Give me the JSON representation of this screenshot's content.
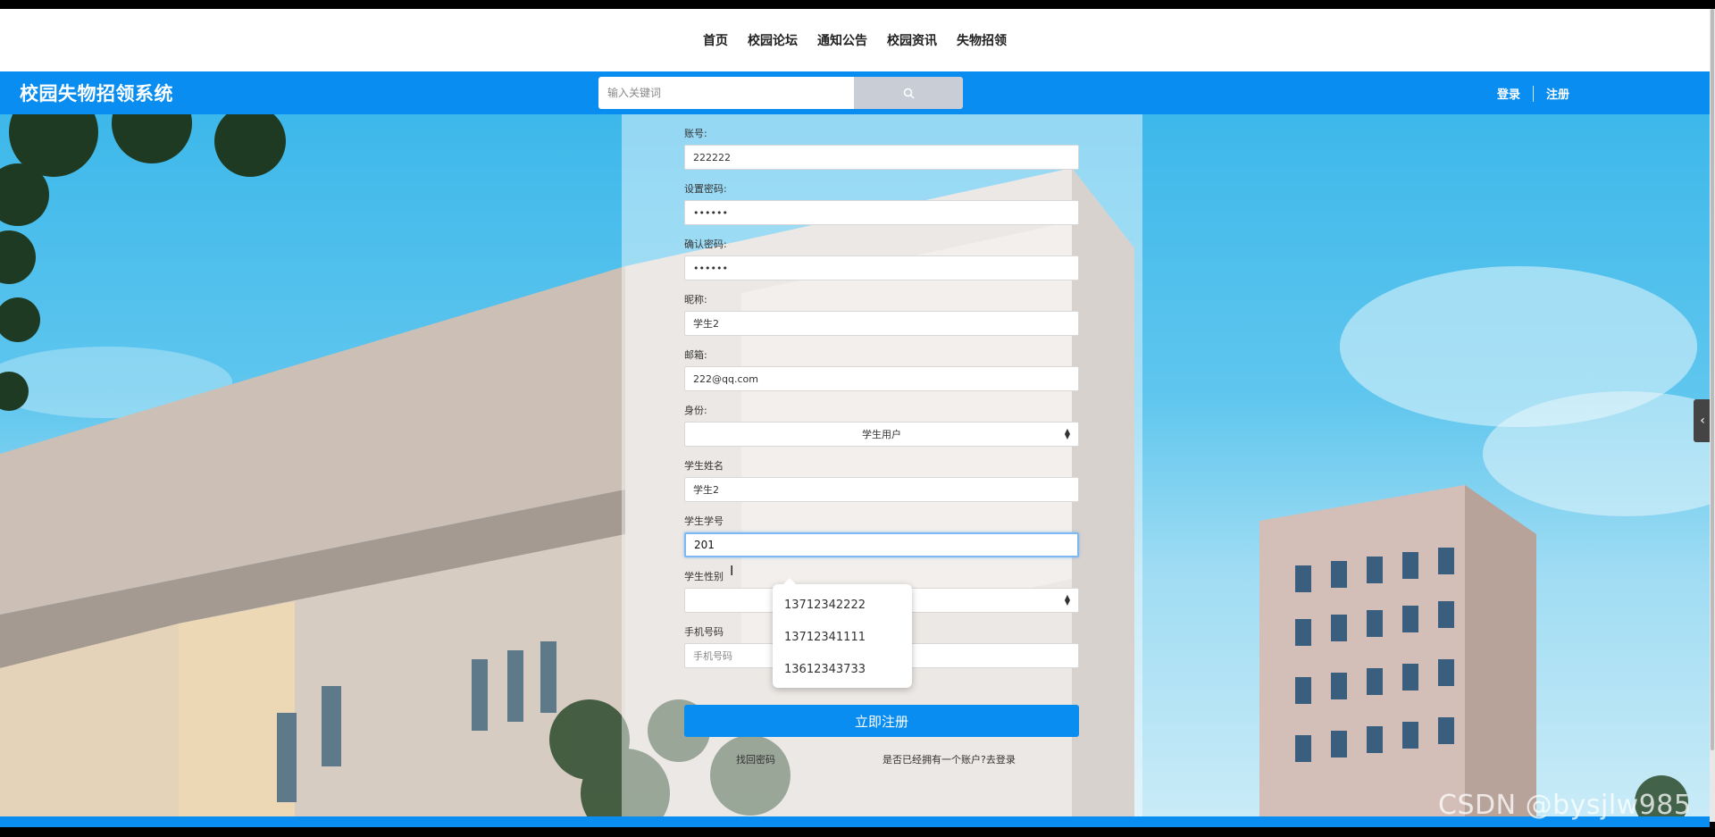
{
  "nav": {
    "items": [
      "首页",
      "校园论坛",
      "通知公告",
      "校园资讯",
      "失物招领"
    ]
  },
  "header": {
    "brand": "校园失物招领系统",
    "search_placeholder": "输入关键词",
    "login": "登录",
    "register": "注册"
  },
  "form": {
    "account_label": "账号:",
    "account_value": "222222",
    "password_label": "设置密码:",
    "password_value": "••••••",
    "confirm_label": "确认密码:",
    "confirm_value": "••••••",
    "nickname_label": "昵称:",
    "nickname_value": "学生2",
    "email_label": "邮箱:",
    "email_value": "222@qq.com",
    "role_label": "身份:",
    "role_value": "学生用户",
    "name_label": "学生姓名",
    "name_value": "学生2",
    "student_no_label": "学生学号",
    "student_no_value": "201",
    "gender_label": "学生性别",
    "gender_value": "",
    "phone_label": "手机号码",
    "phone_placeholder": "手机号码",
    "submit": "立即注册",
    "forgot": "找回密码",
    "have_account": "是否已经拥有一个账户?去登录"
  },
  "autocomplete": [
    "13712342222",
    "13712341111",
    "13612343733"
  ],
  "watermark": "CSDN @bysjlw985",
  "colors": {
    "primary": "#0a8df0",
    "focus_border": "#7eb8f3"
  }
}
